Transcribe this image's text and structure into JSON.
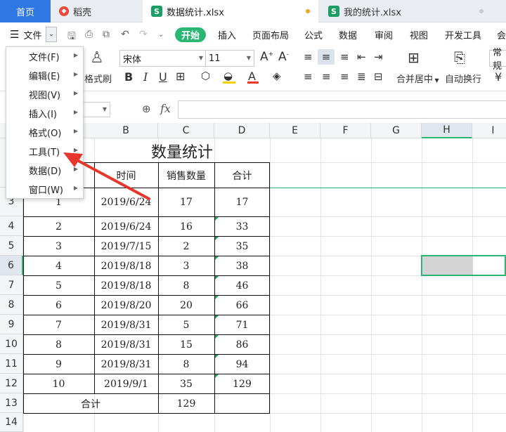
{
  "tabs": {
    "home": "首页",
    "shell": "稻壳",
    "file1": "数据统计.xlsx",
    "file2": "我的统计.xlsx",
    "sheet_icon": "S"
  },
  "menubar": {
    "file_label": "文件",
    "items": [
      "开始",
      "插入",
      "页面布局",
      "公式",
      "数据",
      "审阅",
      "视图",
      "开发工具",
      "会"
    ]
  },
  "ribbon": {
    "format_painter": "格式刷",
    "font_name": "宋体",
    "font_size": "11",
    "merge": "合并居中",
    "wrap": "自动换行",
    "normal": "常规"
  },
  "formula": {
    "fx": "fx"
  },
  "file_menu": {
    "items": [
      "文件(F)",
      "编辑(E)",
      "视图(V)",
      "插入(I)",
      "格式(O)",
      "工具(T)",
      "数据(D)",
      "窗口(W)"
    ]
  },
  "columns": [
    "B",
    "C",
    "D",
    "E",
    "F",
    "G",
    "H",
    "I"
  ],
  "rows": [
    "3",
    "4",
    "5",
    "6",
    "7",
    "8",
    "9",
    "10",
    "11",
    "12",
    "13",
    "14"
  ],
  "sheet": {
    "title": "数量统计",
    "headers": [
      "时间",
      "销售数量",
      "合计"
    ],
    "data": [
      [
        "1",
        "2019/6/24",
        "17",
        "17"
      ],
      [
        "2",
        "2019/6/24",
        "16",
        "33"
      ],
      [
        "3",
        "2019/7/15",
        "2",
        "35"
      ],
      [
        "4",
        "2019/8/18",
        "3",
        "38"
      ],
      [
        "5",
        "2019/8/18",
        "8",
        "46"
      ],
      [
        "6",
        "2019/8/20",
        "20",
        "66"
      ],
      [
        "7",
        "2019/8/31",
        "5",
        "71"
      ],
      [
        "8",
        "2019/8/31",
        "15",
        "86"
      ],
      [
        "9",
        "2019/8/31",
        "8",
        "94"
      ],
      [
        "10",
        "2019/9/1",
        "35",
        "129"
      ]
    ],
    "total_label": "合计",
    "total_value": "129"
  },
  "colors": {
    "accent": "#2f78e3",
    "green": "#2bb673",
    "arrow": "#e8362a"
  }
}
